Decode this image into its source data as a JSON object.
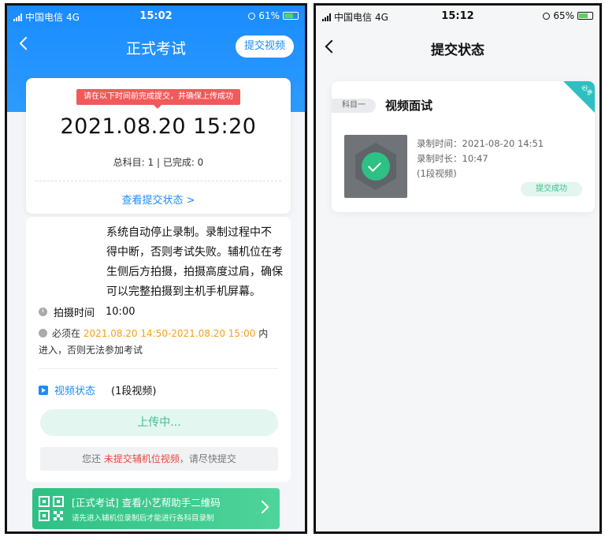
{
  "left": {
    "status_bar": {
      "carrier": "中国电信",
      "network": "4G",
      "time": "15:02",
      "battery": "61%"
    },
    "nav": {
      "title": "正式考试",
      "submit_video": "提交视频"
    },
    "time_card": {
      "tip": "请在以下时间前完成提交，并确保上传成功",
      "deadline": "2021.08.20 15:20",
      "counts": "总科目: 1 | 已完成: 0",
      "view_status": "查看提交状态 >"
    },
    "main": {
      "desc_lines": [
        "系统自动停止录制。录制过程中不",
        "得中断，否则考试失败。辅机位在考",
        "生侧后方拍摄，拍摄高度过肩，确保",
        "可以完整拍摄到主机手机屏幕。"
      ],
      "shoot_label": "拍摄时间",
      "shoot_value": "10:00",
      "must_prefix": "必须在",
      "must_range": "2021.08.20 14:50-2021.08.20 15:00",
      "must_suffix": "内",
      "must_line2": "进入，否则无法参加考试",
      "video_label": "视频状态",
      "video_count": "(1段视频)",
      "upload_btn": "上传中...",
      "warn_prefix": "您还",
      "warn_red": "未提交辅机位视频",
      "warn_suffix": "，请尽快提交"
    },
    "qr_banner": {
      "title": "[正式考试] 查看小艺帮助手二维码",
      "subtitle": "请先进入辅机位录制后才能进行各科目录制"
    }
  },
  "right": {
    "status_bar": {
      "carrier": "中国电信",
      "network": "4G",
      "time": "15:12",
      "battery": "65%"
    },
    "nav": {
      "title": "提交状态"
    },
    "card": {
      "corner": "必考",
      "subject_tag": "科目一",
      "subject_name": "视频面试",
      "record_time": "录制时间：2021-08-20 14:51",
      "record_duration": "录制时长：10:47",
      "segments": "(1段视频)",
      "status": "提交成功"
    }
  },
  "colors": {
    "primary": "#1a8cff",
    "success": "#2ec084",
    "warning": "#f4a01c",
    "danger": "#f05a5a"
  }
}
